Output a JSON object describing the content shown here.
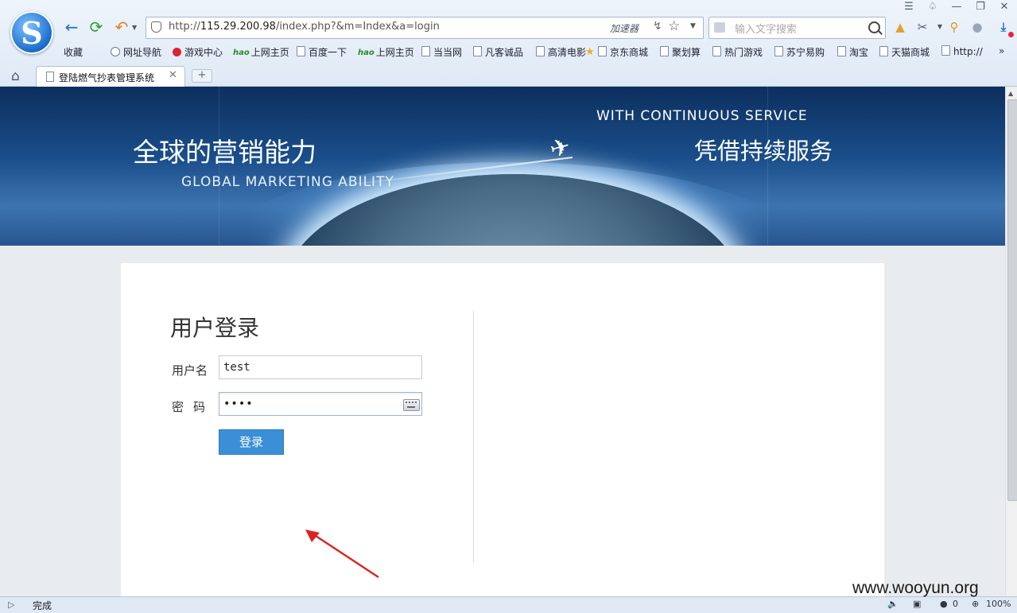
{
  "browser": {
    "url_prefix": "http://",
    "url_host": "115.29.200.98",
    "url_path": "/index.php?&m=Index&a=login",
    "accelerator_label": "加速器",
    "search_placeholder": "输入文字搜索",
    "logo_letter": "S"
  },
  "bookmarks": [
    {
      "label": "收藏"
    },
    {
      "label": "网址导航"
    },
    {
      "label": "游戏中心"
    },
    {
      "label": "上网主页"
    },
    {
      "label": "百度一下"
    },
    {
      "label": "上网主页"
    },
    {
      "label": "当当网"
    },
    {
      "label": "凡客诚品"
    },
    {
      "label": "高清电影"
    },
    {
      "label": "京东商城"
    },
    {
      "label": "聚划算"
    },
    {
      "label": "热门游戏"
    },
    {
      "label": "苏宁易购"
    },
    {
      "label": "淘宝"
    },
    {
      "label": "天猫商城"
    },
    {
      "label": "http://"
    }
  ],
  "bookmark_icon_hao": "hao",
  "tab": {
    "title": "登陆燃气抄表管理系统"
  },
  "banner": {
    "cn_left": "全球的营销能力",
    "en_left": "GLOBAL MARKETING ABILITY",
    "en_right": "WITH CONTINUOUS SERVICE",
    "cn_right": "凭借持续服务"
  },
  "login": {
    "title": "用户登录",
    "username_label": "用户名",
    "password_label": "密码",
    "username_value": "test",
    "password_value": "••••",
    "submit_label": "登录"
  },
  "statusbar": {
    "status": "完成",
    "count": "0",
    "zoom": "100%"
  },
  "watermark": "www.wooyun.org",
  "colors": {
    "button": "#3a8fd6",
    "annotation_arrow": "#d9251d"
  }
}
